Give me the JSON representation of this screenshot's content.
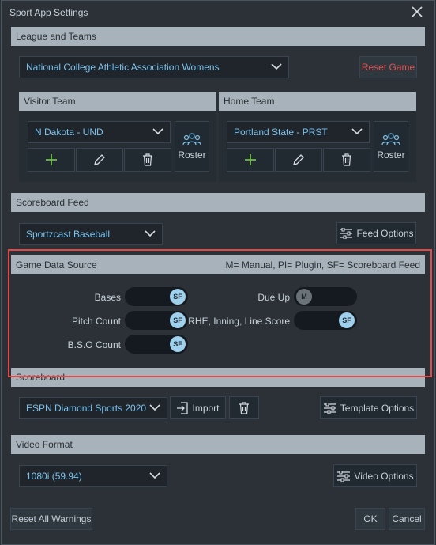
{
  "window": {
    "title": "Sport App Settings"
  },
  "league": {
    "header": "League and Teams",
    "selected": "National College Athletic Association Womens",
    "reset_game": "Reset Game"
  },
  "visitor": {
    "header": "Visitor Team",
    "selected": "N Dakota - UND",
    "roster": "Roster"
  },
  "home": {
    "header": "Home Team",
    "selected": "Portland State - PRST",
    "roster": "Roster"
  },
  "scoreboard_feed": {
    "header": "Scoreboard Feed",
    "selected": "Sportzcast Baseball",
    "feed_options": "Feed Options"
  },
  "game_data_source": {
    "header": "Game Data Source",
    "legend": "M= Manual, PI= Plugin, SF= Scoreboard Feed",
    "items": {
      "bases": {
        "label": "Bases",
        "value": "SF"
      },
      "pitch_count": {
        "label": "Pitch Count",
        "value": "SF"
      },
      "bso_count": {
        "label": "B.S.O Count",
        "value": "SF"
      },
      "due_up": {
        "label": "Due Up",
        "value": "M"
      },
      "rhe": {
        "label": "RHE, Inning, Line Score",
        "value": "SF"
      }
    }
  },
  "scoreboard": {
    "header": "Scoreboard",
    "selected": "ESPN Diamond Sports 2020",
    "import": "Import",
    "template_options": "Template Options"
  },
  "video_format": {
    "header": "Video Format",
    "selected": "1080i (59.94)",
    "video_options": "Video Options"
  },
  "footer": {
    "reset_warnings": "Reset All Warnings",
    "ok": "OK",
    "cancel": "Cancel"
  },
  "colors": {
    "accent_text": "#7cc2ec",
    "reset_text": "#e05454",
    "plus_green": "#6fbf4a",
    "highlight": "#e24a4a"
  }
}
